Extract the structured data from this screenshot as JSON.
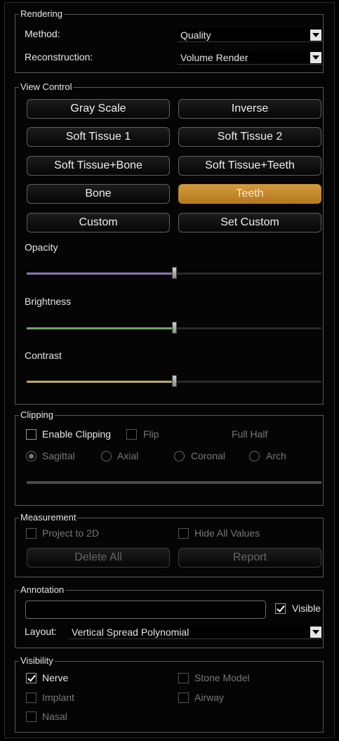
{
  "rendering": {
    "legend": "Rendering",
    "method_label": "Method:",
    "method_value": "Quality",
    "reconstruction_label": "Reconstruction:",
    "reconstruction_value": "Volume Render"
  },
  "view_control": {
    "legend": "View Control",
    "buttons": [
      "Gray Scale",
      "Inverse",
      "Soft Tissue 1",
      "Soft Tissue 2",
      "Soft Tissue+Bone",
      "Soft Tissue+Teeth",
      "Bone",
      "Teeth",
      "Custom",
      "Set Custom"
    ],
    "active_button": "Teeth",
    "active_color": "#c88a2e",
    "sliders": [
      {
        "label": "Opacity",
        "value": 0.5,
        "color": "#8a76ad"
      },
      {
        "label": "Brightness",
        "value": 0.5,
        "color": "#6aa860"
      },
      {
        "label": "Contrast",
        "value": 0.5,
        "color": "#c0a860"
      }
    ]
  },
  "clipping": {
    "legend": "Clipping",
    "enable_label": "Enable Clipping",
    "enable_checked": false,
    "flip_label": "Flip",
    "full_half_label": "Full Half",
    "planes": [
      {
        "label": "Sagittal",
        "checked": true
      },
      {
        "label": "Axial",
        "checked": false
      },
      {
        "label": "Coronal",
        "checked": false
      },
      {
        "label": "Arch",
        "checked": false
      }
    ]
  },
  "measurement": {
    "legend": "Measurement",
    "project_label": "Project to 2D",
    "hide_values_label": "Hide All Values",
    "delete_all_label": "Delete All",
    "report_label": "Report"
  },
  "annotation": {
    "legend": "Annotation",
    "text_value": "",
    "visible_label": "Visible",
    "visible_checked": true,
    "layout_label": "Layout:",
    "layout_value": "Vertical Spread Polynomial"
  },
  "visibility": {
    "legend": "Visibility",
    "nerve_label": "Nerve",
    "nerve_checked": true,
    "stone_model_label": "Stone Model",
    "implant_label": "Implant",
    "airway_label": "Airway",
    "nasal_label": "Nasal"
  }
}
